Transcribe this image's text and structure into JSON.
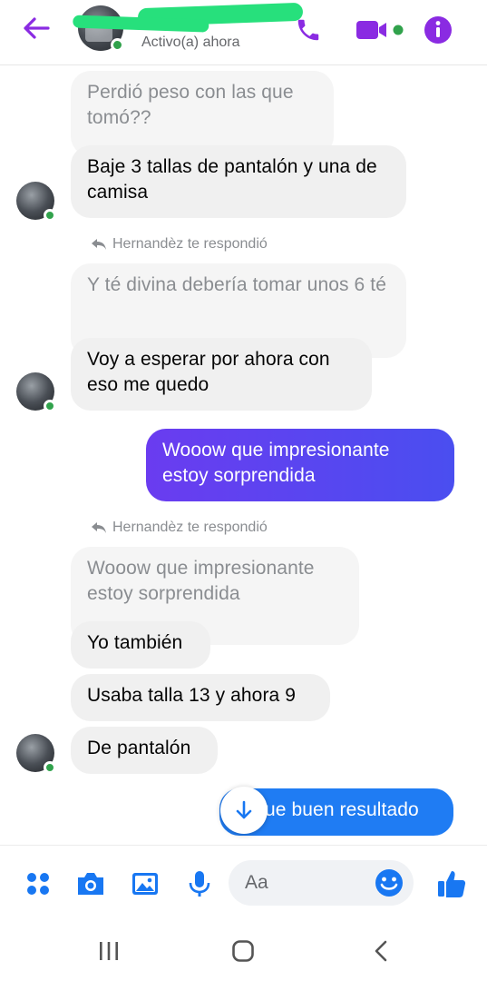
{
  "header": {
    "back_icon": "arrow-left-icon",
    "contact_name": "",
    "status": "Activo(a) ahora",
    "accent_color": "#8a2be2"
  },
  "messages": {
    "m1_quoted": "Perdió peso con las que tomó??",
    "m1_reply": "Baje 3 tallas de pantalón y una de camisa",
    "reply_notice_1": "Hernandèz te respondió",
    "m2_quoted": "Y té divina debería tomar unos 6 té",
    "m2_reply": "Voy a esperar por ahora con eso me quedo",
    "m3_out": "Wooow que impresionante estoy sorprendida",
    "reply_notice_2": "Hernandèz te respondió",
    "m4_quoted": "Wooow que impresionante estoy sorprendida",
    "m4_reply1": "Yo también",
    "m4_reply2": "Usaba talla 13 y ahora 9",
    "m4_reply3": "De pantalón",
    "m5_out_partial": "ue buen resultado"
  },
  "composer": {
    "placeholder": "Aa",
    "icons": [
      "menu-dots-icon",
      "camera-icon",
      "gallery-icon",
      "microphone-icon",
      "emoji-icon",
      "thumbs-up-icon"
    ]
  },
  "navbar": {
    "icons": [
      "recent-apps-icon",
      "home-icon",
      "back-icon"
    ]
  }
}
